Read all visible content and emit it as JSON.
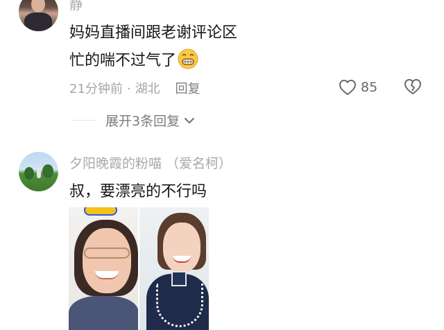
{
  "comments": [
    {
      "username": "静",
      "line1": "妈妈直播间跟老谢评论区",
      "line2": "忙的喘不过气了",
      "emoji": "grinning-face-emoji",
      "time": "21分钟前",
      "separator": "·",
      "location": "湖北",
      "reply_label": "回复",
      "like_count": "85",
      "expand_label": "展开3条回复"
    },
    {
      "username": "夕阳晚霞的粉喵 （爱名柯）",
      "text": "叔，要漂亮的不行吗"
    }
  ],
  "icons": {
    "like": "heart-outline-icon",
    "dislike": "broken-heart-icon",
    "expand": "chevron-down-icon"
  },
  "colors": {
    "username": "#a9a9a9",
    "text": "#161616",
    "meta": "#a5a5a5",
    "emoji_face": "#f7c948"
  }
}
